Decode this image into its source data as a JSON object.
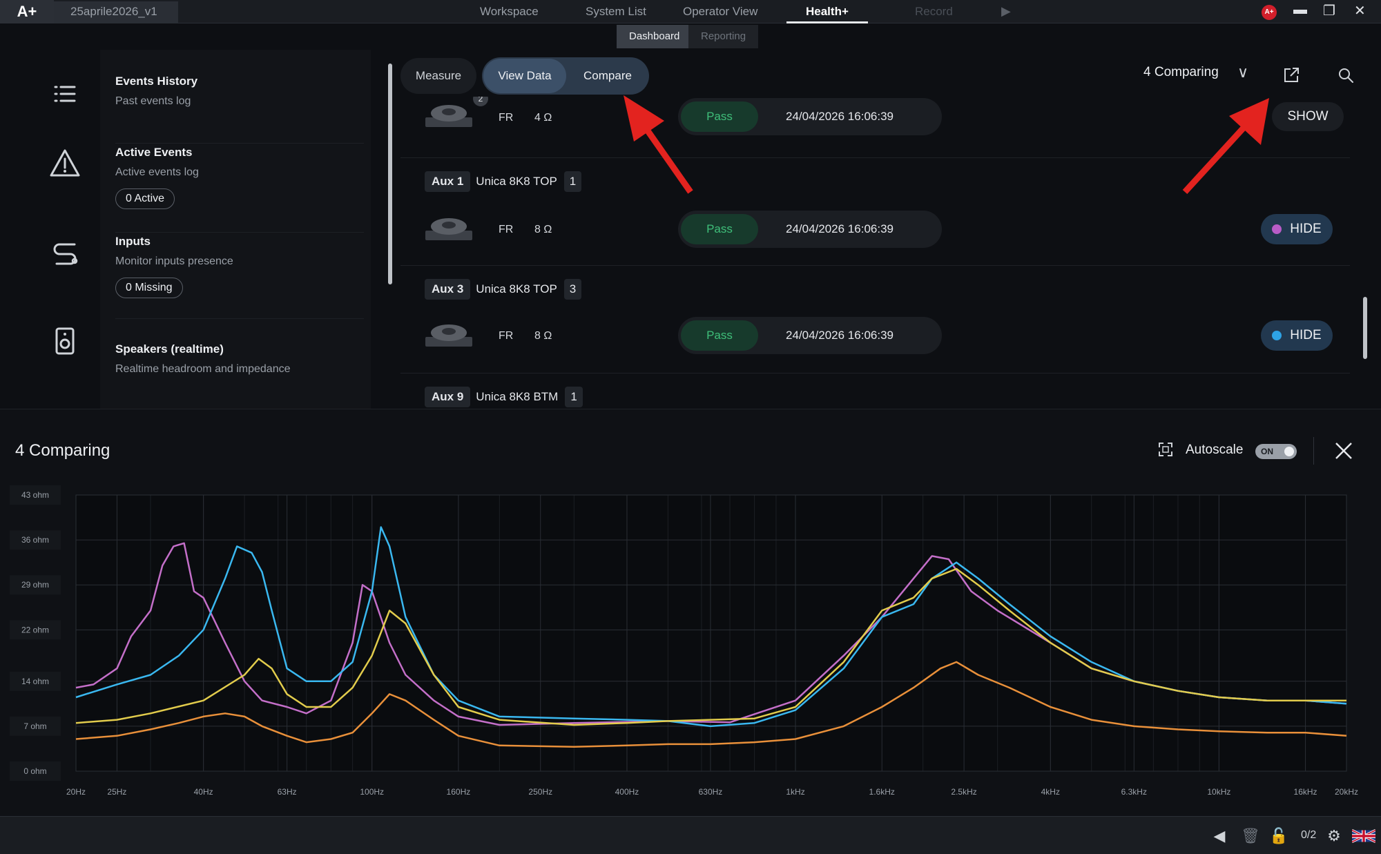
{
  "titlebar": {
    "logo": "A+",
    "project_tab": "25aprile2026_v1",
    "nav": [
      "Workspace",
      "System List",
      "Operator View",
      "Health+",
      "Record"
    ],
    "active_nav": "Health+",
    "avatar": "A+"
  },
  "subtabs": [
    "Dashboard",
    "Reporting"
  ],
  "sidebar": {
    "sections": [
      {
        "title": "Events History",
        "subtitle": "Past events log",
        "icon": "list-icon"
      },
      {
        "title": "Active Events",
        "subtitle": "Active events log",
        "pill": "0 Active",
        "icon": "warning-icon"
      },
      {
        "title": "Inputs",
        "subtitle": "Monitor inputs presence",
        "pill": "0 Missing",
        "icon": "input-cable-icon"
      },
      {
        "title": "Speakers (realtime)",
        "subtitle": "Realtime headroom and impedance",
        "icon": "speaker-icon"
      }
    ]
  },
  "toolbar": {
    "measure": "Measure",
    "view_data": "View Data",
    "compare": "Compare",
    "comparing_dropdown": "4 Comparing"
  },
  "rows": [
    {
      "badge": "2",
      "mode": "FR",
      "ohm": "4 Ω",
      "status": "Pass",
      "timestamp": "24/04/2026 16:06:39",
      "button": "SHOW"
    },
    {
      "header": {
        "aux": "Aux 1",
        "model": "Unica 8K8 TOP",
        "num": "1"
      },
      "mode": "FR",
      "ohm": "8 Ω",
      "status": "Pass",
      "timestamp": "24/04/2026 16:06:39",
      "button": "HIDE",
      "dot_color": "#b95cc7"
    },
    {
      "header": {
        "aux": "Aux 3",
        "model": "Unica 8K8 TOP",
        "num": "3"
      },
      "mode": "FR",
      "ohm": "8 Ω",
      "status": "Pass",
      "timestamp": "24/04/2026 16:06:39",
      "button": "HIDE",
      "dot_color": "#2ea3e6"
    },
    {
      "header": {
        "aux": "Aux 9",
        "model": "Unica 8K8 BTM",
        "num": "1"
      }
    }
  ],
  "chart_panel": {
    "title": "4 Comparing",
    "autoscale_label": "Autoscale",
    "autoscale_state": "ON"
  },
  "chart_data": {
    "type": "line",
    "xscale": "log",
    "xlim": [
      20,
      20000
    ],
    "ylim": [
      0,
      43
    ],
    "y_ticks": [
      0,
      7,
      14,
      22,
      29,
      36,
      43
    ],
    "y_tick_labels": [
      "0 ohm",
      "7 ohm",
      "14 ohm",
      "22 ohm",
      "29 ohm",
      "36 ohm",
      "43 ohm"
    ],
    "x_ticks": [
      20,
      25,
      40,
      63,
      100,
      160,
      250,
      400,
      630,
      1000,
      1600,
      2500,
      4000,
      6300,
      10000,
      16000,
      20000
    ],
    "x_tick_labels": [
      "20Hz",
      "25Hz",
      "40Hz",
      "63Hz",
      "100Hz",
      "160Hz",
      "250Hz",
      "400Hz",
      "630Hz",
      "1kHz",
      "1.6kHz",
      "2.5kHz",
      "4kHz",
      "6.3kHz",
      "10kHz",
      "16kHz",
      "20kHz"
    ],
    "grid": true,
    "series": [
      {
        "color": "#c46fc9",
        "points": [
          [
            20,
            13
          ],
          [
            22,
            13.5
          ],
          [
            25,
            16
          ],
          [
            27,
            21
          ],
          [
            30,
            25
          ],
          [
            32,
            32
          ],
          [
            34,
            35
          ],
          [
            36,
            35.5
          ],
          [
            38,
            28
          ],
          [
            40,
            27
          ],
          [
            45,
            20
          ],
          [
            50,
            14
          ],
          [
            55,
            11
          ],
          [
            63,
            10
          ],
          [
            70,
            9
          ],
          [
            80,
            11
          ],
          [
            90,
            20
          ],
          [
            95,
            29
          ],
          [
            100,
            28
          ],
          [
            110,
            20
          ],
          [
            120,
            15
          ],
          [
            140,
            11
          ],
          [
            160,
            8.5
          ],
          [
            200,
            7.2
          ],
          [
            300,
            7.5
          ],
          [
            500,
            7.8
          ],
          [
            700,
            7.6
          ],
          [
            1000,
            11
          ],
          [
            1300,
            18
          ],
          [
            1600,
            24
          ],
          [
            1900,
            30
          ],
          [
            2100,
            33.5
          ],
          [
            2300,
            33
          ],
          [
            2600,
            28
          ],
          [
            3000,
            25
          ],
          [
            4000,
            20
          ],
          [
            5000,
            16
          ],
          [
            6300,
            14
          ],
          [
            8000,
            12.5
          ],
          [
            10000,
            11.5
          ],
          [
            13000,
            11
          ],
          [
            16000,
            11
          ],
          [
            20000,
            10.5
          ]
        ]
      },
      {
        "color": "#3ab8f0",
        "points": [
          [
            20,
            11.5
          ],
          [
            25,
            13.5
          ],
          [
            30,
            15
          ],
          [
            35,
            18
          ],
          [
            40,
            22
          ],
          [
            45,
            30
          ],
          [
            48,
            35
          ],
          [
            52,
            34
          ],
          [
            55,
            31
          ],
          [
            58,
            25
          ],
          [
            63,
            16
          ],
          [
            70,
            14
          ],
          [
            80,
            14
          ],
          [
            90,
            17
          ],
          [
            100,
            28
          ],
          [
            105,
            38
          ],
          [
            110,
            35
          ],
          [
            120,
            24
          ],
          [
            140,
            15
          ],
          [
            160,
            11
          ],
          [
            200,
            8.5
          ],
          [
            300,
            8.2
          ],
          [
            400,
            8
          ],
          [
            500,
            7.8
          ],
          [
            630,
            7
          ],
          [
            800,
            7.5
          ],
          [
            1000,
            9.5
          ],
          [
            1300,
            16
          ],
          [
            1600,
            24
          ],
          [
            1900,
            26
          ],
          [
            2100,
            30
          ],
          [
            2400,
            32.5
          ],
          [
            2700,
            30
          ],
          [
            3200,
            26
          ],
          [
            4000,
            21
          ],
          [
            5000,
            17
          ],
          [
            6300,
            14
          ],
          [
            8000,
            12.5
          ],
          [
            10000,
            11.5
          ],
          [
            13000,
            11
          ],
          [
            16000,
            11
          ],
          [
            20000,
            10.5
          ]
        ]
      },
      {
        "color": "#e2cc4c",
        "points": [
          [
            20,
            7.5
          ],
          [
            25,
            8
          ],
          [
            30,
            9
          ],
          [
            40,
            11
          ],
          [
            50,
            15
          ],
          [
            54,
            17.5
          ],
          [
            58,
            16
          ],
          [
            63,
            12
          ],
          [
            70,
            10
          ],
          [
            80,
            10
          ],
          [
            90,
            13
          ],
          [
            100,
            18
          ],
          [
            110,
            25
          ],
          [
            120,
            23
          ],
          [
            140,
            15
          ],
          [
            160,
            10
          ],
          [
            200,
            8
          ],
          [
            300,
            7.2
          ],
          [
            400,
            7.5
          ],
          [
            500,
            7.8
          ],
          [
            630,
            8
          ],
          [
            800,
            8.2
          ],
          [
            1000,
            10
          ],
          [
            1300,
            17
          ],
          [
            1600,
            25
          ],
          [
            1900,
            27
          ],
          [
            2100,
            30
          ],
          [
            2400,
            31.5
          ],
          [
            2700,
            29
          ],
          [
            3200,
            25
          ],
          [
            4000,
            20
          ],
          [
            5000,
            16
          ],
          [
            6300,
            14
          ],
          [
            8000,
            12.5
          ],
          [
            10000,
            11.5
          ],
          [
            13000,
            11
          ],
          [
            16000,
            11
          ],
          [
            20000,
            11
          ]
        ]
      },
      {
        "color": "#e9903a",
        "points": [
          [
            20,
            5
          ],
          [
            25,
            5.5
          ],
          [
            30,
            6.5
          ],
          [
            35,
            7.5
          ],
          [
            40,
            8.5
          ],
          [
            45,
            9
          ],
          [
            50,
            8.5
          ],
          [
            55,
            7
          ],
          [
            63,
            5.5
          ],
          [
            70,
            4.5
          ],
          [
            80,
            5
          ],
          [
            90,
            6
          ],
          [
            100,
            9
          ],
          [
            110,
            12
          ],
          [
            120,
            11
          ],
          [
            140,
            8
          ],
          [
            160,
            5.5
          ],
          [
            200,
            4
          ],
          [
            300,
            3.8
          ],
          [
            400,
            4
          ],
          [
            500,
            4.2
          ],
          [
            630,
            4.2
          ],
          [
            800,
            4.5
          ],
          [
            1000,
            5
          ],
          [
            1300,
            7
          ],
          [
            1600,
            10
          ],
          [
            1900,
            13
          ],
          [
            2200,
            16
          ],
          [
            2400,
            17
          ],
          [
            2700,
            15
          ],
          [
            3200,
            13
          ],
          [
            4000,
            10
          ],
          [
            5000,
            8
          ],
          [
            6300,
            7
          ],
          [
            8000,
            6.5
          ],
          [
            10000,
            6.2
          ],
          [
            13000,
            6
          ],
          [
            16000,
            6
          ],
          [
            20000,
            5.5
          ]
        ]
      }
    ]
  },
  "statusbar": {
    "counter": "0/2"
  }
}
